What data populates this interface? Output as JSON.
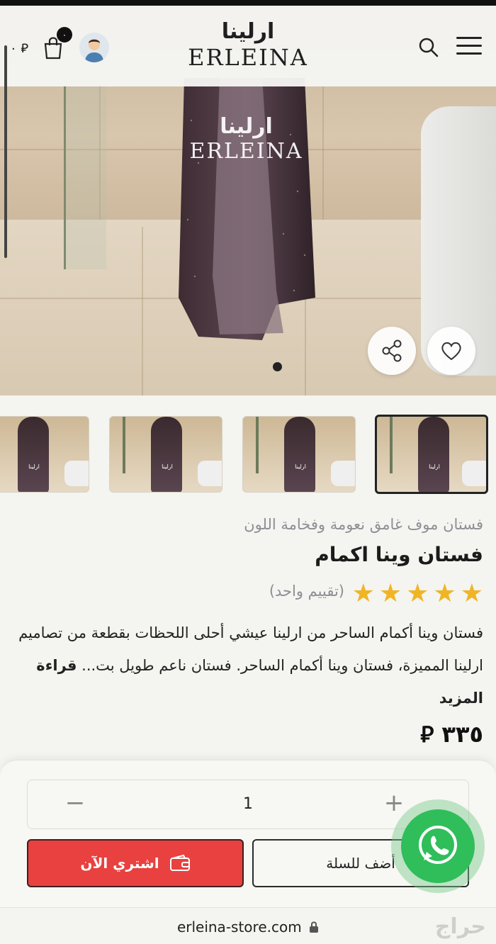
{
  "header": {
    "logo_ar": "ارلينا",
    "logo_en": "ERLEINA",
    "cart_count": "٠",
    "cart_total": "٠ ⃁",
    "icons": [
      "menu-icon",
      "search-icon",
      "avatar-icon",
      "cart-icon"
    ]
  },
  "hero": {
    "watermark_ar": "ارلينا",
    "watermark_en": "ERLEINA",
    "slide_index": 1,
    "icons": [
      "share-icon",
      "heart-icon"
    ]
  },
  "thumbnails": [
    {
      "label": "ارلينا"
    },
    {
      "label": "ارلينا"
    },
    {
      "label": "ارلينا"
    },
    {
      "label": "ارلينا",
      "active": true
    }
  ],
  "product": {
    "subtitle": "فستان موف غامق نعومة وفخامة اللون",
    "title": "فستان وينا اكمام",
    "rating": 5,
    "rating_count": "(تقييم واحد)",
    "description": "فستان وينا أكمام الساحر من ارلينا عيشي أحلى اللحظات بقطعة من تصاميم ارلينا المميزة، فستان وينا أكمام الساحر. فستان ناعم طويل بت...",
    "read_more": "قراءة المزيد",
    "price": "٣٣٥ ⃁"
  },
  "actions": {
    "quantity": "1",
    "minus": "−",
    "plus": "+",
    "buy_now": "اشتري الآن",
    "add_to_cart": "أضف للسلة"
  },
  "browser": {
    "url": "erleina-store.com",
    "watermark": "حراج"
  },
  "colors": {
    "buy_button": "#e8413f",
    "star": "#f0b526",
    "whatsapp": "#2fbe5a"
  }
}
